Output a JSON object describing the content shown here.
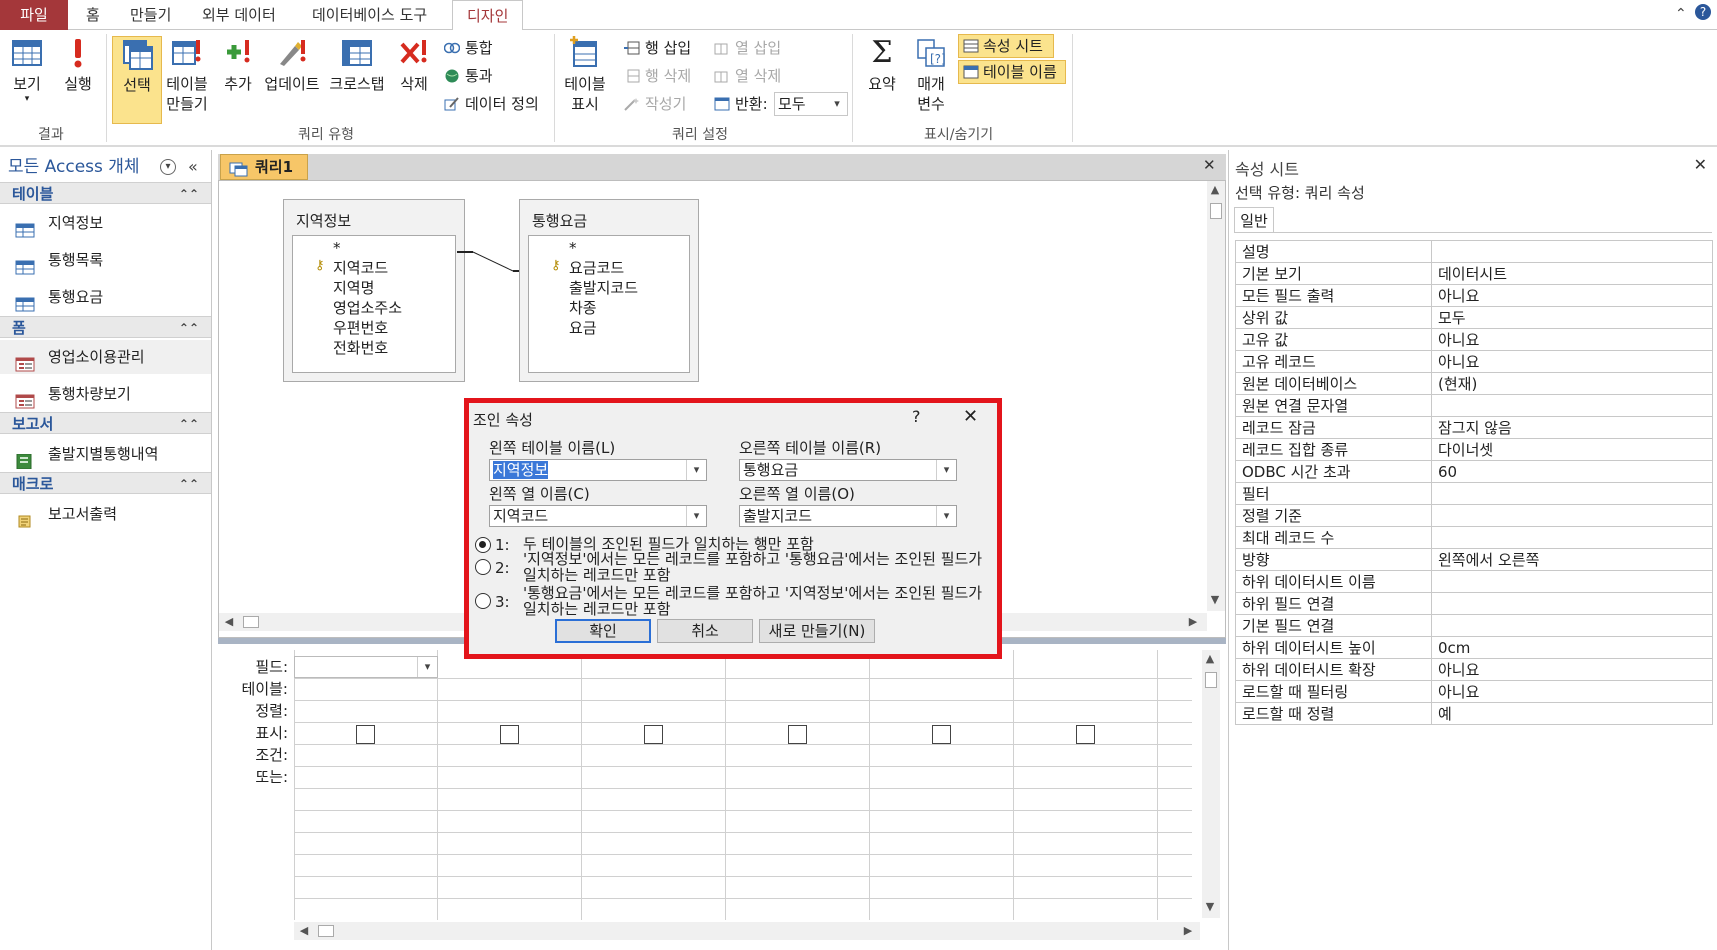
{
  "tabs": {
    "file": "파일",
    "home": "홈",
    "create": "만들기",
    "external": "외부 데이터",
    "dbtools": "데이터베이스 도구",
    "design": "디자인"
  },
  "ribbon": {
    "results": {
      "view": "보기",
      "run": "실행",
      "group": "결과"
    },
    "query_type": {
      "select": "선택",
      "make_table": "테이블\n만들기",
      "make_table_1": "테이블",
      "make_table_2": "만들기",
      "append": "추가",
      "update": "업데이트",
      "crosstab": "크로스탭",
      "delete": "삭제",
      "union": "통합",
      "pass_through": "통과",
      "data_definition": "데이터 정의",
      "group": "쿼리 유형"
    },
    "query_setup": {
      "show_table_1": "테이블",
      "show_table_2": "표시",
      "insert_rows": "행 삽입",
      "delete_rows": "행 삭제",
      "builder": "작성기",
      "insert_columns": "열 삽입",
      "delete_columns": "열 삭제",
      "return_label": "반환:",
      "return_value": "모두",
      "group": "쿼리 설정"
    },
    "show_hide": {
      "totals": "요약",
      "parameters_1": "매개",
      "parameters_2": "변수",
      "property_sheet": "속성 시트",
      "table_names": "테이블 이름",
      "group": "표시/숨기기"
    }
  },
  "nav": {
    "title": "모든 Access 개체",
    "sections": [
      {
        "label": "테이블",
        "items": [
          "지역정보",
          "통행목록",
          "통행요금"
        ]
      },
      {
        "label": "폼",
        "items": [
          "영업소이용관리",
          "통행차량보기"
        ]
      },
      {
        "label": "보고서",
        "items": [
          "출발지별통행내역"
        ]
      },
      {
        "label": "매크로",
        "items": [
          "보고서출력"
        ]
      }
    ]
  },
  "document": {
    "tab": "쿼리1",
    "tables": [
      {
        "name": "지역정보",
        "fields": [
          "*",
          "지역코드",
          "지역명",
          "영업소주소",
          "우편번호",
          "전화번호"
        ]
      },
      {
        "name": "통행요금",
        "fields": [
          "*",
          "요금코드",
          "출발지코드",
          "차종",
          "요금"
        ]
      }
    ],
    "grid_labels": [
      "필드:",
      "테이블:",
      "정렬:",
      "표시:",
      "조건:",
      "또는:"
    ]
  },
  "dialog": {
    "title": "조인 속성",
    "help": "?",
    "close": "✕",
    "left_table_label": "왼쪽 테이블 이름(L)",
    "left_table_value": "지역정보",
    "right_table_label": "오른쪽 테이블 이름(R)",
    "right_table_value": "통행요금",
    "left_column_label": "왼쪽 열 이름(C)",
    "left_column_value": "지역코드",
    "right_column_label": "오른쪽 열 이름(O)",
    "right_column_value": "출발지코드",
    "options": [
      {
        "num": "1:",
        "text": "두 테이블의 조인된 필드가 일치하는 행만 포함",
        "selected": true
      },
      {
        "num": "2:",
        "text": "'지역정보'에서는 모든 레코드를 포함하고 '통행요금'에서는 조인된 필드가 일치하는 레코드만 포함",
        "selected": false
      },
      {
        "num": "3:",
        "text": "'통행요금'에서는 모든 레코드를 포함하고 '지역정보'에서는 조인된 필드가 일치하는 레코드만 포함",
        "selected": false
      }
    ],
    "ok": "확인",
    "cancel": "취소",
    "new": "새로 만들기(N)"
  },
  "property_sheet": {
    "title": "속성 시트",
    "selection_type": "선택 유형: 쿼리 속성",
    "tab": "일반",
    "rows": [
      [
        "설명",
        ""
      ],
      [
        "기본 보기",
        "데이터시트"
      ],
      [
        "모든 필드 출력",
        "아니요"
      ],
      [
        "상위 값",
        "모두"
      ],
      [
        "고유 값",
        "아니요"
      ],
      [
        "고유 레코드",
        "아니요"
      ],
      [
        "원본 데이터베이스",
        "(현재)"
      ],
      [
        "원본 연결 문자열",
        ""
      ],
      [
        "레코드 잠금",
        "잠그지 않음"
      ],
      [
        "레코드 집합 종류",
        "다이너셋"
      ],
      [
        "ODBC 시간 초과",
        "60"
      ],
      [
        "필터",
        ""
      ],
      [
        "정렬 기준",
        ""
      ],
      [
        "최대 레코드 수",
        ""
      ],
      [
        "방향",
        "왼쪽에서 오른쪽"
      ],
      [
        "하위 데이터시트 이름",
        ""
      ],
      [
        "하위 필드 연결",
        ""
      ],
      [
        "기본 필드 연결",
        ""
      ],
      [
        "하위 데이터시트 높이",
        "0cm"
      ],
      [
        "하위 데이터시트 확장",
        "아니요"
      ],
      [
        "로드할 때 필터링",
        "아니요"
      ],
      [
        "로드할 때 정렬",
        "예"
      ]
    ]
  },
  "colors": {
    "file_tab": "#a4373a",
    "highlight": "#fbe38d",
    "dialog_border": "#e3141b",
    "nav_text": "#2b579a"
  }
}
